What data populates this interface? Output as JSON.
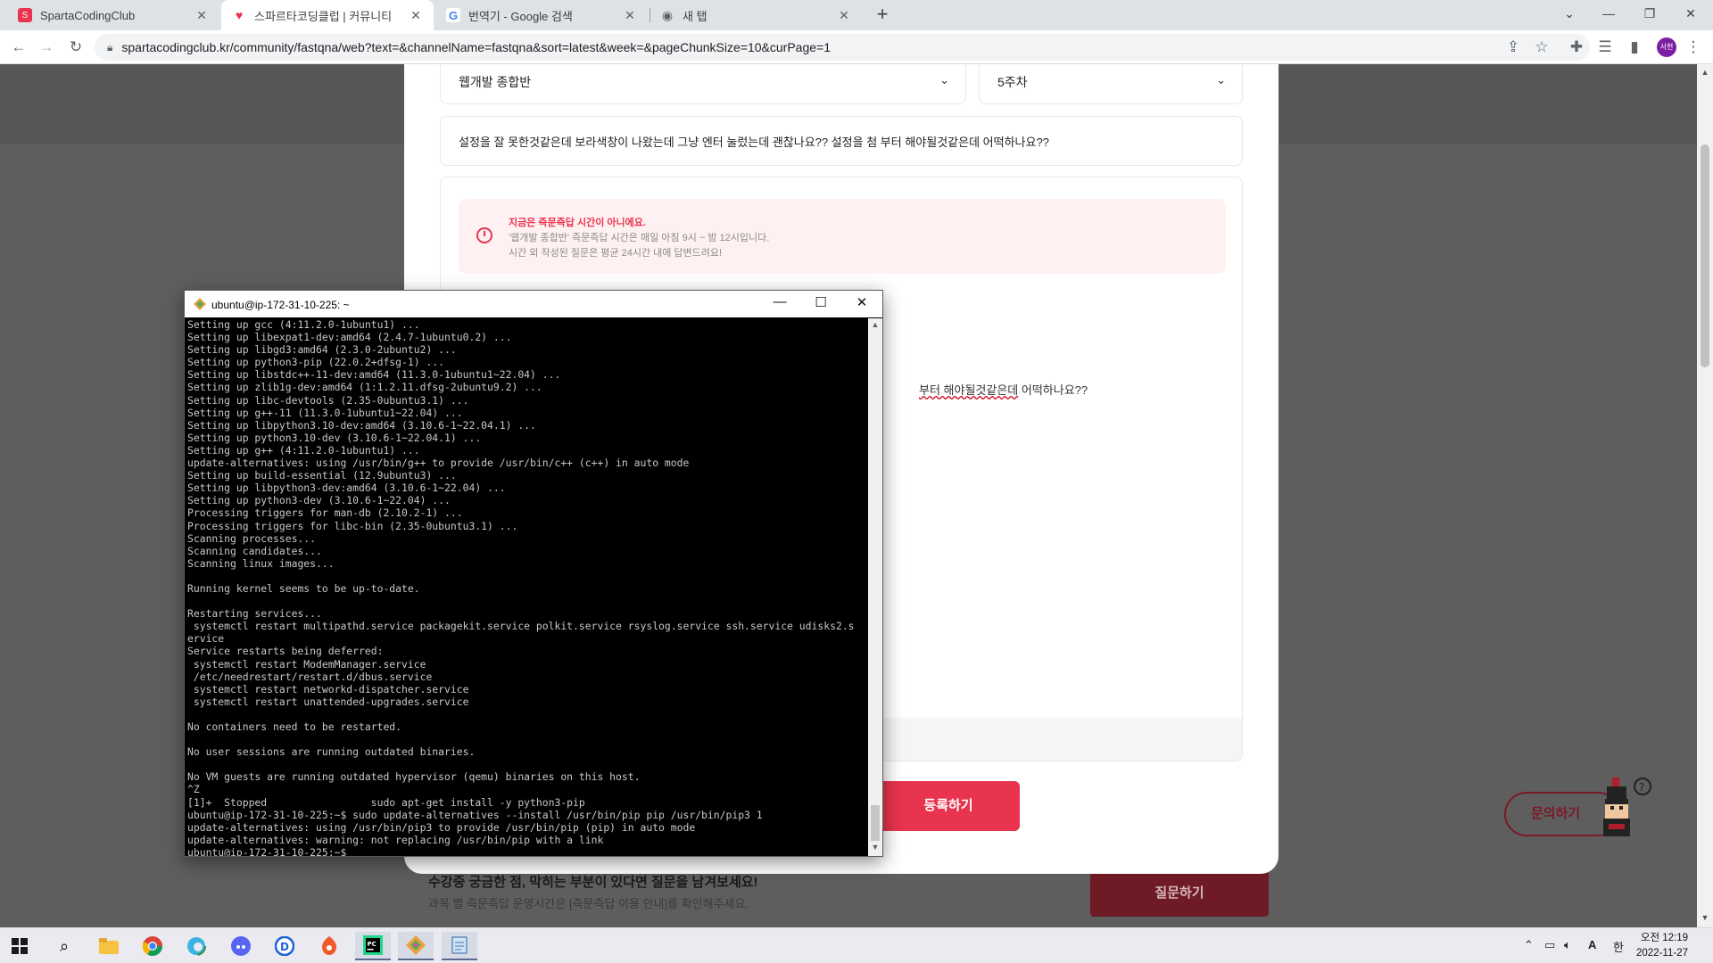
{
  "browser": {
    "tabs": [
      {
        "title": "SpartaCodingClub",
        "active": false
      },
      {
        "title": "스파르타코딩클럽 | 커뮤니티",
        "active": true
      },
      {
        "title": "번역기 - Google 검색",
        "active": false
      },
      {
        "title": "새 탭",
        "active": false
      }
    ],
    "url": "spartacodingclub.kr/community/fastqna/web?text=&channelName=fastqna&sort=latest&week=&pageChunkSize=10&curPage=1",
    "profile_initials": "서현"
  },
  "form": {
    "course_select": "웹개발 종합반",
    "week_select": "5주차",
    "title": "설정을 잘 못한것같은데 보라색창이 나왔는데 그냥 엔터 눌렀는데 괜찮나요?? 설정을 첨 부터 해야될것같은데 어떡하나요??",
    "notice": {
      "heading": "지금은 즉문즉답 시간이 아니에요.",
      "line1": "'웹개발 종합반' 즉문즉답 시간은 매일 아침 9시 ~ 밤 12시입니다.",
      "line2": "시간 외 작성된 질문은 평균 24시간 내에 답변드려요!"
    },
    "body_visible_fragment": "부터 해야될것같은데",
    "body_visible_tail": " 어떡하나요??",
    "submit_label": "등록하기"
  },
  "footer": {
    "prompt": "수강중 궁금한 점, 막히는 부분이 있다면 질문을 남겨보세요!",
    "subprompt": "과목 별 즉문즉답 운영시간은 [즉문즉답 이용 안내]를 확인해주세요.",
    "ask_label": "질문하기",
    "inquiry_label": "문의하기"
  },
  "terminal": {
    "title": "ubuntu@ip-172-31-10-225: ~",
    "lines": [
      "Setting up gcc (4:11.2.0-1ubuntu1) ...",
      "Setting up libexpat1-dev:amd64 (2.4.7-1ubuntu0.2) ...",
      "Setting up libgd3:amd64 (2.3.0-2ubuntu2) ...",
      "Setting up python3-pip (22.0.2+dfsg-1) ...",
      "Setting up libstdc++-11-dev:amd64 (11.3.0-1ubuntu1~22.04) ...",
      "Setting up zlib1g-dev:amd64 (1:1.2.11.dfsg-2ubuntu9.2) ...",
      "Setting up libc-devtools (2.35-0ubuntu3.1) ...",
      "Setting up g++-11 (11.3.0-1ubuntu1~22.04) ...",
      "Setting up libpython3.10-dev:amd64 (3.10.6-1~22.04.1) ...",
      "Setting up python3.10-dev (3.10.6-1~22.04.1) ...",
      "Setting up g++ (4:11.2.0-1ubuntu1) ...",
      "update-alternatives: using /usr/bin/g++ to provide /usr/bin/c++ (c++) in auto mode",
      "Setting up build-essential (12.9ubuntu3) ...",
      "Setting up libpython3-dev:amd64 (3.10.6-1~22.04) ...",
      "Setting up python3-dev (3.10.6-1~22.04) ...",
      "Processing triggers for man-db (2.10.2-1) ...",
      "Processing triggers for libc-bin (2.35-0ubuntu3.1) ...",
      "Scanning processes...",
      "Scanning candidates...",
      "Scanning linux images...",
      "",
      "Running kernel seems to be up-to-date.",
      "",
      "Restarting services...",
      " systemctl restart multipathd.service packagekit.service polkit.service rsyslog.service ssh.service udisks2.s",
      "ervice",
      "Service restarts being deferred:",
      " systemctl restart ModemManager.service",
      " /etc/needrestart/restart.d/dbus.service",
      " systemctl restart networkd-dispatcher.service",
      " systemctl restart unattended-upgrades.service",
      "",
      "No containers need to be restarted.",
      "",
      "No user sessions are running outdated binaries.",
      "",
      "No VM guests are running outdated hypervisor (qemu) binaries on this host.",
      "^Z",
      "[1]+  Stopped                 sudo apt-get install -y python3-pip",
      "ubuntu@ip-172-31-10-225:~$ sudo update-alternatives --install /usr/bin/pip pip /usr/bin/pip3 1",
      "update-alternatives: using /usr/bin/pip3 to provide /usr/bin/pip (pip) in auto mode",
      "update-alternatives: warning: not replacing /usr/bin/pip with a link",
      "ubuntu@ip-172-31-10-225:~$ "
    ]
  },
  "taskbar": {
    "time": "오전 12:19",
    "date": "2022-11-27",
    "ime": "A",
    "lang": "한"
  },
  "colors": {
    "brand_red": "#e8344e",
    "notice_bg": "#fff1f2",
    "terminal_bg": "#000000"
  }
}
